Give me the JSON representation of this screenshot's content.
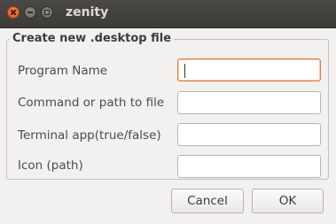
{
  "window": {
    "title": "zenity"
  },
  "form": {
    "title": "Create new .desktop file",
    "fields": [
      {
        "label": "Program Name",
        "value": "",
        "focused": true
      },
      {
        "label": "Command or path to file",
        "value": ""
      },
      {
        "label": "Terminal app(true/false)",
        "value": ""
      },
      {
        "label": "Icon (path)",
        "value": ""
      }
    ]
  },
  "buttons": {
    "cancel": "Cancel",
    "ok": "OK"
  },
  "colors": {
    "titlebar": "#3c3b37",
    "close_button": "#e0561e",
    "focus_border": "#e9793f",
    "background": "#f2f1f0"
  }
}
